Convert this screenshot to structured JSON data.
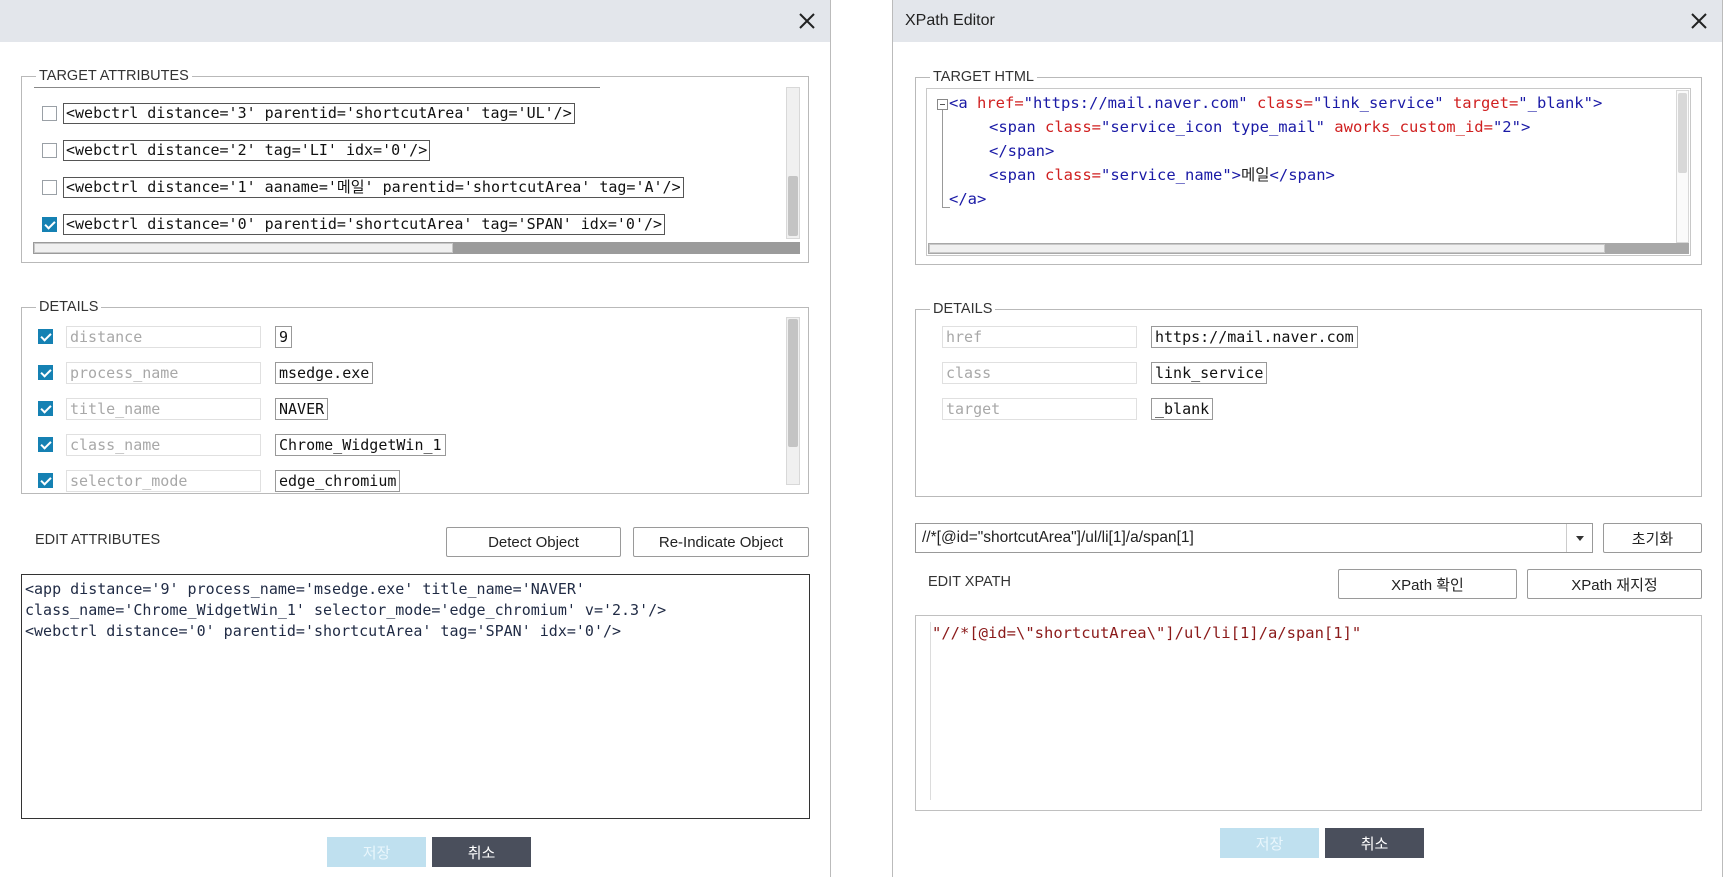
{
  "left": {
    "target_attributes_label": "TARGET ATTRIBUTES",
    "target_rows": [
      {
        "checked": false,
        "text": "<webctrl distance='3' parentid='shortcutArea' tag='UL'/>"
      },
      {
        "checked": false,
        "text": "<webctrl distance='2' tag='LI' idx='0'/>"
      },
      {
        "checked": false,
        "text": "<webctrl distance='1' aaname='메일' parentid='shortcutArea' tag='A'/>"
      },
      {
        "checked": true,
        "text": "<webctrl distance='0' parentid='shortcutArea' tag='SPAN' idx='0'/>"
      }
    ],
    "details_label": "DETAILS",
    "details": [
      {
        "checked": true,
        "key": "distance",
        "value": "9"
      },
      {
        "checked": true,
        "key": "process_name",
        "value": "msedge.exe"
      },
      {
        "checked": true,
        "key": "title_name",
        "value": "NAVER"
      },
      {
        "checked": true,
        "key": "class_name",
        "value": "Chrome_WidgetWin_1"
      },
      {
        "checked": true,
        "key": "selector_mode",
        "value": "edge_chromium"
      }
    ],
    "edit_attributes_label": "EDIT ATTRIBUTES",
    "detect_object_label": "Detect Object",
    "reindicate_object_label": "Re-Indicate Object",
    "edit_text": "<app distance='9' process_name='msedge.exe' title_name='NAVER'\nclass_name='Chrome_WidgetWin_1' selector_mode='edge_chromium' v='2.3'/>\n<webctrl distance='0' parentid='shortcutArea' tag='SPAN' idx='0'/>",
    "save_label": "저장",
    "cancel_label": "취소"
  },
  "right": {
    "title": "XPath Editor",
    "target_html_label": "TARGET HTML",
    "html": {
      "l1_open": "<a ",
      "l1_a1": "href=",
      "l1_v1": "\"https://mail.naver.com\"",
      "l1_a2": " class=",
      "l1_v2": "\"link_service\"",
      "l1_a3": " target=",
      "l1_v3": "\"_blank\"",
      "l1_close": ">",
      "l2_open": "<span ",
      "l2_a1": "class=",
      "l2_v1": "\"service_icon type_mail\"",
      "l2_a2": " aworks_custom_id=",
      "l2_v2": "\"2\"",
      "l2_close": ">",
      "l3": "</span>",
      "l4_open": "<span ",
      "l4_a1": "class=",
      "l4_v1": "\"service_name\"",
      "l4_close": ">",
      "l4_text": "메일",
      "l4_end": "</span>",
      "l5": "</a>"
    },
    "details_label": "DETAILS",
    "details": [
      {
        "key": "href",
        "value": "https://mail.naver.com"
      },
      {
        "key": "class",
        "value": "link_service"
      },
      {
        "key": "target",
        "value": "_blank"
      }
    ],
    "xpath_value": "//*[@id=\"shortcutArea\"]/ul/li[1]/a/span[1]",
    "reset_label": "초기화",
    "edit_xpath_label": "EDIT XPATH",
    "xpath_check_label": "XPath 확인",
    "xpath_reset_label": "XPath 재지정",
    "xpath_edit_text": "\"//*[@id=\\\"shortcutArea\\\"]/ul/li[1]/a/span[1]\"",
    "save_label": "저장",
    "cancel_label": "취소"
  },
  "colors": {
    "checkbox_checked": "#1581b3",
    "save_disabled": "#bfe0ef",
    "cancel_bg": "#4a4f5c",
    "xml_tag": "#1a1aa6",
    "xml_attr": "#d02020",
    "xpath_text": "#8b1a1a"
  }
}
